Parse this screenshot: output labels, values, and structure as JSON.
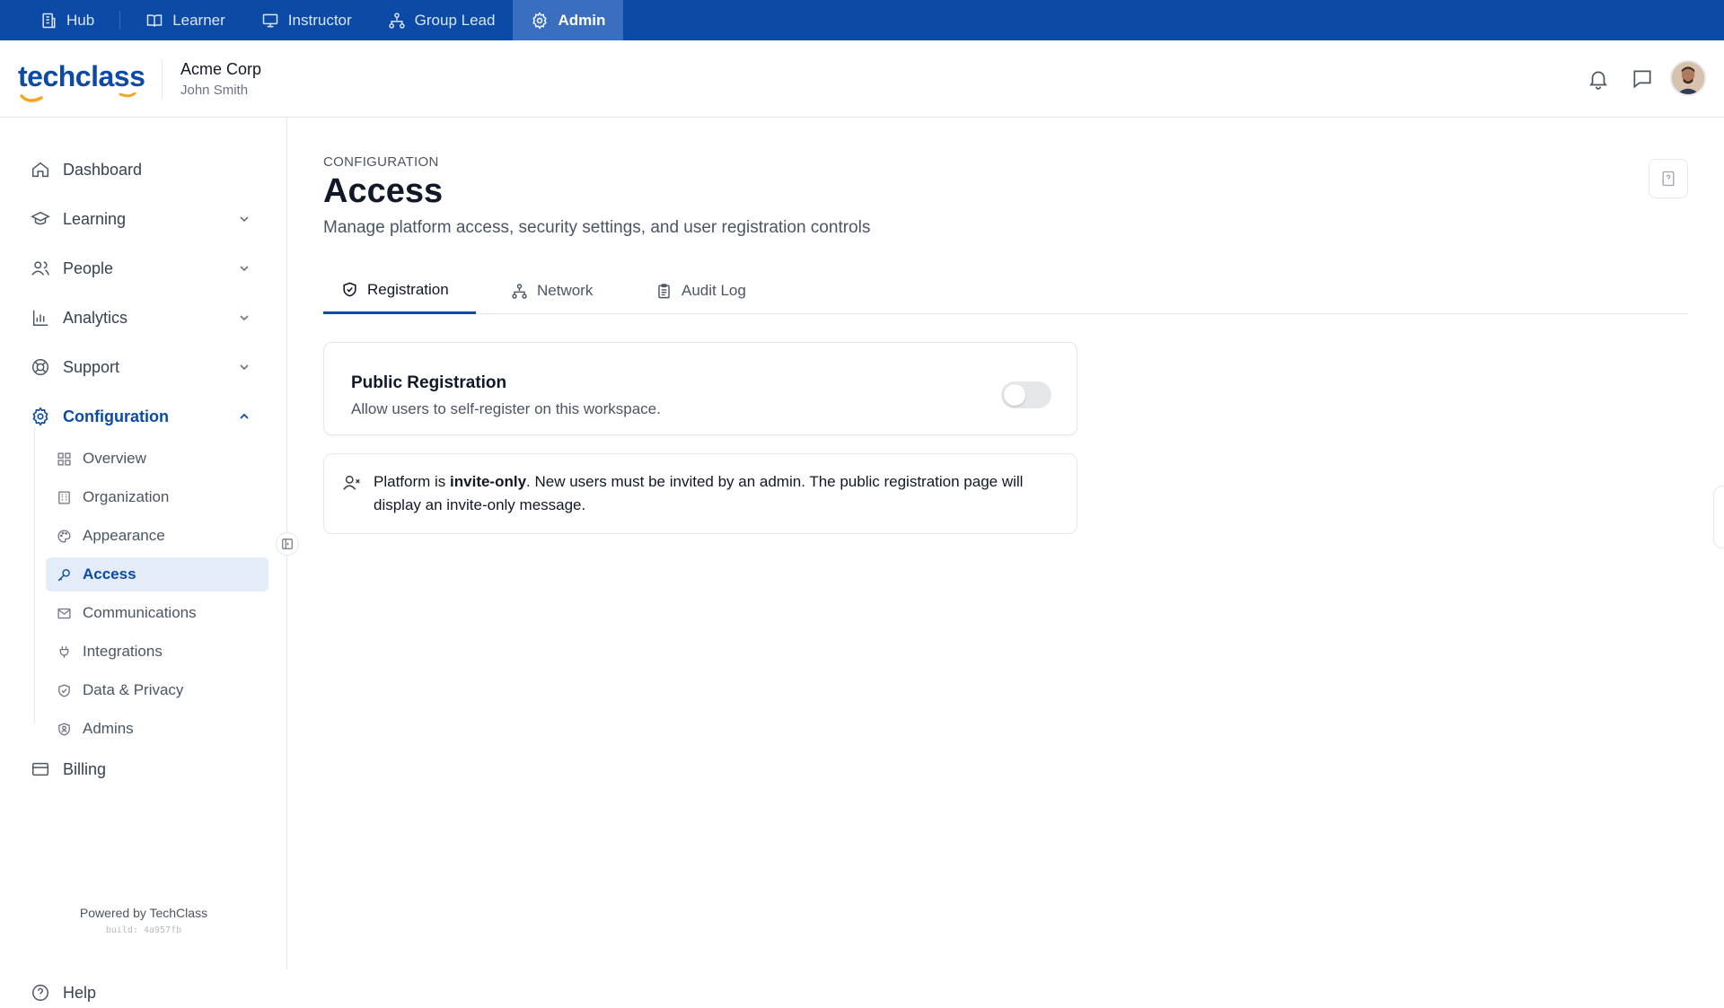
{
  "rolebar": {
    "items": [
      {
        "label": "Hub",
        "icon": "building-icon"
      },
      {
        "label": "Learner",
        "icon": "book-icon"
      },
      {
        "label": "Instructor",
        "icon": "presentation-icon"
      },
      {
        "label": "Group Lead",
        "icon": "network-icon"
      },
      {
        "label": "Admin",
        "icon": "gear-icon",
        "active": true
      }
    ]
  },
  "header": {
    "logo_text": "techclass",
    "org_name": "Acme Corp",
    "user_name": "John Smith"
  },
  "sidebar": {
    "dashboard": "Dashboard",
    "learning": "Learning",
    "people": "People",
    "analytics": "Analytics",
    "support": "Support",
    "configuration": "Configuration",
    "sub": [
      "Overview",
      "Organization",
      "Appearance",
      "Access",
      "Communications",
      "Integrations",
      "Data & Privacy",
      "Admins"
    ],
    "billing": "Billing",
    "help": "Help",
    "powered": "Powered by TechClass",
    "build": "build: 4a957fb"
  },
  "main": {
    "eyebrow": "CONFIGURATION",
    "title": "Access",
    "description": "Manage platform access, security settings, and user registration controls",
    "tabs": [
      "Registration",
      "Network",
      "Audit Log"
    ],
    "card": {
      "title": "Public Registration",
      "subtitle": "Allow users to self-register on this workspace.",
      "toggle_on": false
    },
    "notice": {
      "prefix": "Platform is ",
      "bold": "invite-only",
      "suffix": ". New users must be invited by an admin. The public registration page will display an invite-only message."
    }
  },
  "colors": {
    "brand": "#0b4aa6",
    "accent_orange": "#f5a623",
    "active_bg": "#e3ecf8"
  }
}
